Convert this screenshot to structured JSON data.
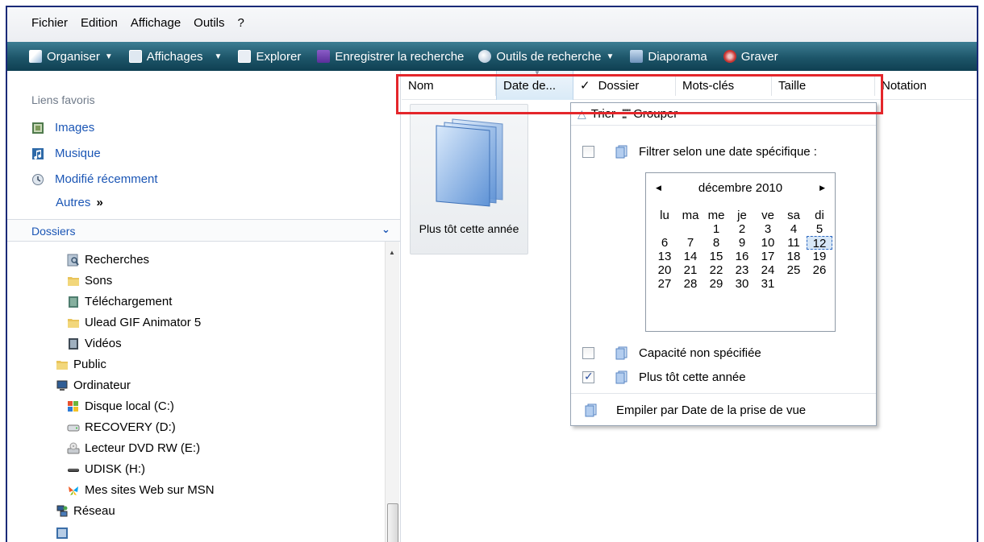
{
  "menubar": [
    "Fichier",
    "Edition",
    "Affichage",
    "Outils",
    "?"
  ],
  "toolbar": {
    "organiser": "Organiser",
    "affichages": "Affichages",
    "explorer": "Explorer",
    "enregistrer": "Enregistrer la recherche",
    "outils_recherche": "Outils de recherche",
    "diaporama": "Diaporama",
    "graver": "Graver"
  },
  "sidebar": {
    "favorites_title": "Liens favoris",
    "favorites": [
      "Images",
      "Musique",
      "Modifié récemment"
    ],
    "more": "Autres",
    "more_glyph": "»",
    "folders_title": "Dossiers",
    "tree": [
      "Recherches",
      "Sons",
      "Téléchargement",
      "Ulead GIF Animator 5",
      "Vidéos",
      "Public",
      "Ordinateur",
      "Disque local (C:)",
      "RECOVERY (D:)",
      "Lecteur DVD RW (E:)",
      "UDISK (H:)",
      "Mes sites Web sur MSN",
      "Réseau"
    ]
  },
  "columns": {
    "nom": "Nom",
    "date": "Date de...",
    "check": "✓",
    "dossier": "Dossier",
    "mots_cles": "Mots-clés",
    "taille": "Taille",
    "notation": "Notation"
  },
  "tile": {
    "label": "Plus tôt cette année"
  },
  "dropdown": {
    "sort": "Trier",
    "group": "Grouper",
    "filter_date": "Filtrer selon une date spécifique :",
    "unspecified": "Capacité non spécifiée",
    "earlier_year": "Plus tôt cette année",
    "stack_by": "Empiler par Date de la prise de vue"
  },
  "calendar": {
    "month": "décembre 2010",
    "weekdays": [
      "lu",
      "ma",
      "me",
      "je",
      "ve",
      "sa",
      "di"
    ],
    "first_weekday_index": 2,
    "days_in_month": 31,
    "today": 12
  },
  "colors": {
    "link": "#1b56b5",
    "highlight": "#e4262b",
    "toolbar": "#1d5569"
  }
}
